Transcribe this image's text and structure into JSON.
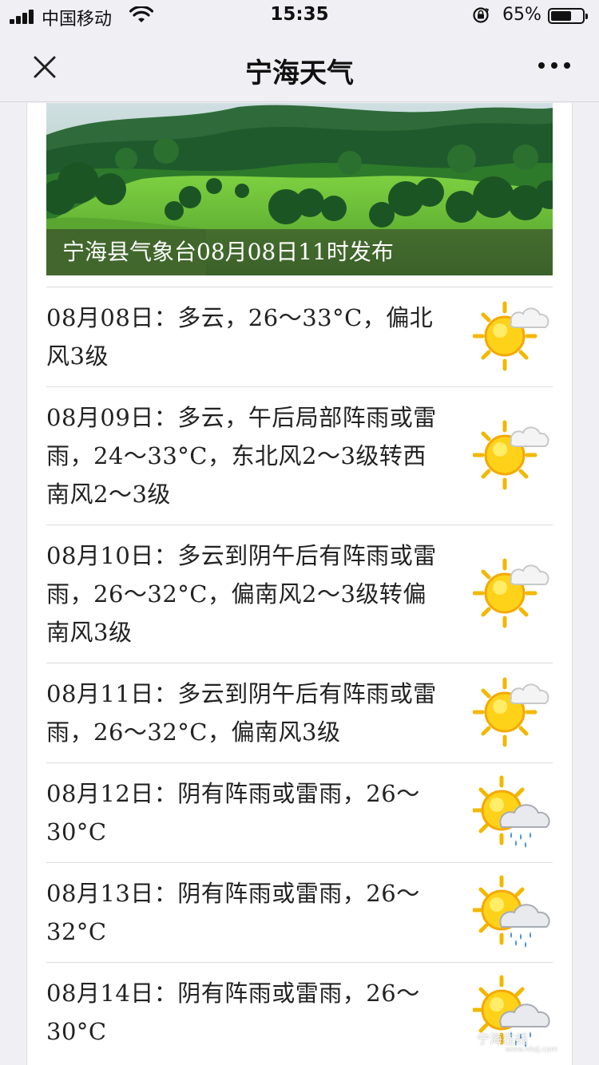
{
  "status_bar": {
    "carrier": "中国移动",
    "time": "15:35",
    "battery_percent": "65%",
    "battery_level": 0.65
  },
  "nav": {
    "title": "宁海天气",
    "close_icon": "close-icon",
    "more_icon": "more-icon"
  },
  "banner": {
    "caption": "宁海县气象台08月08日11时发布"
  },
  "forecast": [
    {
      "text": "08月08日：多云，26～33°C，偏北风3级",
      "icon": "partly-cloudy-icon"
    },
    {
      "text": "08月09日：多云，午后局部阵雨或雷雨，24～33°C，东北风2～3级转西南风2～3级",
      "icon": "partly-cloudy-icon"
    },
    {
      "text": "08月10日：多云到阴午后有阵雨或雷雨，26～32°C，偏南风2～3级转偏南风3级",
      "icon": "partly-cloudy-icon"
    },
    {
      "text": "08月11日：多云到阴午后有阵雨或雷雨，26～32°C，偏南风3级",
      "icon": "partly-cloudy-icon"
    },
    {
      "text": "08月12日：阴有阵雨或雷雨，26～30°C",
      "icon": "sun-rain-icon"
    },
    {
      "text": "08月13日：阴有阵雨或雷雨，26～32°C",
      "icon": "sun-rain-icon"
    },
    {
      "text": "08月14日：阴有阵雨或雷雨，26～30°C",
      "icon": "sun-rain-icon"
    }
  ],
  "watermark": {
    "text": "宁海在线",
    "url": "www.nhzj.com"
  }
}
